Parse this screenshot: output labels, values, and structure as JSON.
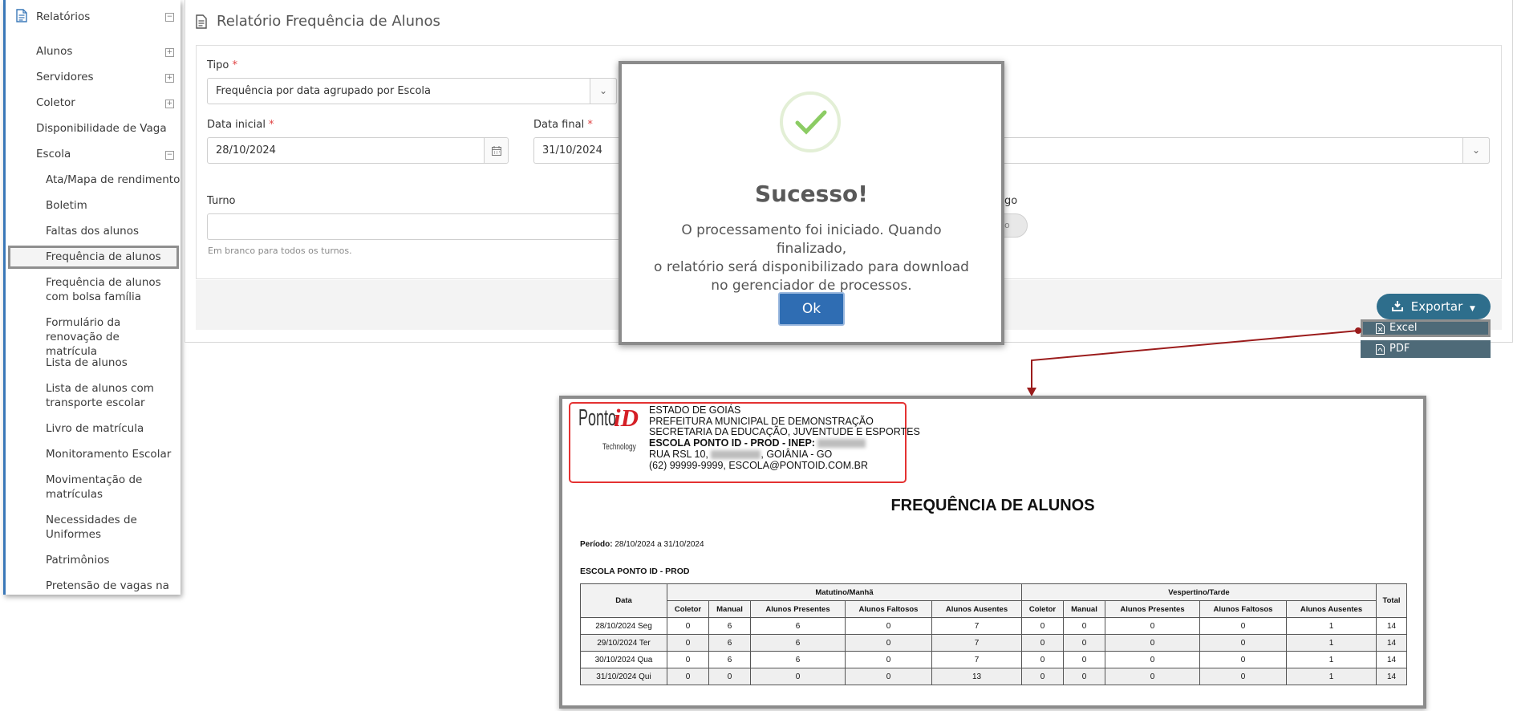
{
  "sidebar": {
    "section_label": "Relatórios",
    "items": [
      {
        "label": "Alunos"
      },
      {
        "label": "Servidores"
      },
      {
        "label": "Coletor"
      },
      {
        "label": "Disponibilidade de Vaga"
      },
      {
        "label": "Escola"
      }
    ],
    "escola_items": [
      {
        "label": "Ata/Mapa de rendimento"
      },
      {
        "label": "Boletim"
      },
      {
        "label": "Faltas dos alunos"
      },
      {
        "label": "Frequência de alunos"
      },
      {
        "label": "Frequência de alunos com bolsa família"
      },
      {
        "label": "Formulário da renovação de matrícula"
      },
      {
        "label": "Lista de alunos"
      },
      {
        "label": "Lista de alunos com transporte escolar"
      },
      {
        "label": "Livro de matrícula"
      },
      {
        "label": "Monitoramento Escolar"
      },
      {
        "label": "Movimentação de matrículas"
      },
      {
        "label": "Necessidades de Uniformes"
      },
      {
        "label": "Patrimônios"
      },
      {
        "label": "Pretensão de vagas na"
      }
    ]
  },
  "page": {
    "title": "Relatório Frequência de Alunos"
  },
  "form": {
    "tipo_label": "Tipo",
    "tipo_value": "Frequência por data agrupado por Escola",
    "data_inicial_label": "Data inicial",
    "data_inicial_value": "28/10/2024",
    "data_final_label": "Data final",
    "data_final_value": "31/10/2024",
    "turno_label": "Turno",
    "turno_help": "Em branco para todos os turnos.",
    "partial_label": "go",
    "partial_toggle": "io",
    "required_mark": "*"
  },
  "export": {
    "button_label": "Exportar",
    "menu": [
      {
        "label": "Excel"
      },
      {
        "label": "PDF"
      }
    ]
  },
  "modal": {
    "title": "Sucesso!",
    "message_line1": "O processamento foi iniciado. Quando finalizado,",
    "message_line2": "o relatório será disponibilizado para download",
    "message_line3": "no gerenciador de processos.",
    "ok_label": "Ok"
  },
  "report": {
    "logo_main": "Ponto",
    "logo_id": "iD",
    "logo_sub": "Technology",
    "header_lines": [
      "ESTADO DE GOIÁS",
      "PREFEITURA MUNICIPAL DE DEMONSTRAÇÃO",
      "SECRETARIA DA EDUCAÇÃO, JUVENTUDE E ESPORTES",
      "ESCOLA PONTO ID - PROD - INEP:",
      "RUA RSL 10,",
      ", GOIÂNIA - GO",
      "(62) 99999-9999, ESCOLA@PONTOID.COM.BR"
    ],
    "title": "FREQUÊNCIA DE ALUNOS",
    "period_label": "Período:",
    "period_value": "28/10/2024 a 31/10/2024",
    "school": "ESCOLA PONTO ID - PROD",
    "table": {
      "col_data": "Data",
      "col_total": "Total",
      "group_morning": "Matutino/Manhã",
      "group_afternoon": "Vespertino/Tarde",
      "sub_headers": [
        "Coletor",
        "Manual",
        "Alunos Presentes",
        "Alunos Faltosos",
        "Alunos Ausentes"
      ],
      "rows": [
        {
          "date": "28/10/2024 Seg",
          "m": [
            "0",
            "6",
            "6",
            "0",
            "7"
          ],
          "a": [
            "0",
            "0",
            "0",
            "0",
            "1"
          ],
          "total": "14"
        },
        {
          "date": "29/10/2024 Ter",
          "m": [
            "0",
            "6",
            "6",
            "0",
            "7"
          ],
          "a": [
            "0",
            "0",
            "0",
            "0",
            "1"
          ],
          "total": "14"
        },
        {
          "date": "30/10/2024 Qua",
          "m": [
            "0",
            "6",
            "6",
            "0",
            "7"
          ],
          "a": [
            "0",
            "0",
            "0",
            "0",
            "1"
          ],
          "total": "14"
        },
        {
          "date": "31/10/2024 Qui",
          "m": [
            "0",
            "0",
            "0",
            "0",
            "13"
          ],
          "a": [
            "0",
            "0",
            "0",
            "0",
            "1"
          ],
          "total": "14"
        }
      ]
    }
  },
  "colors": {
    "accent": "#3a78b8",
    "export_button": "#2e6e8c",
    "ok_button": "#2f6db3",
    "success_check": "#8ccc64",
    "highlight_red": "#e43232",
    "arrow": "#9b1c1c"
  }
}
